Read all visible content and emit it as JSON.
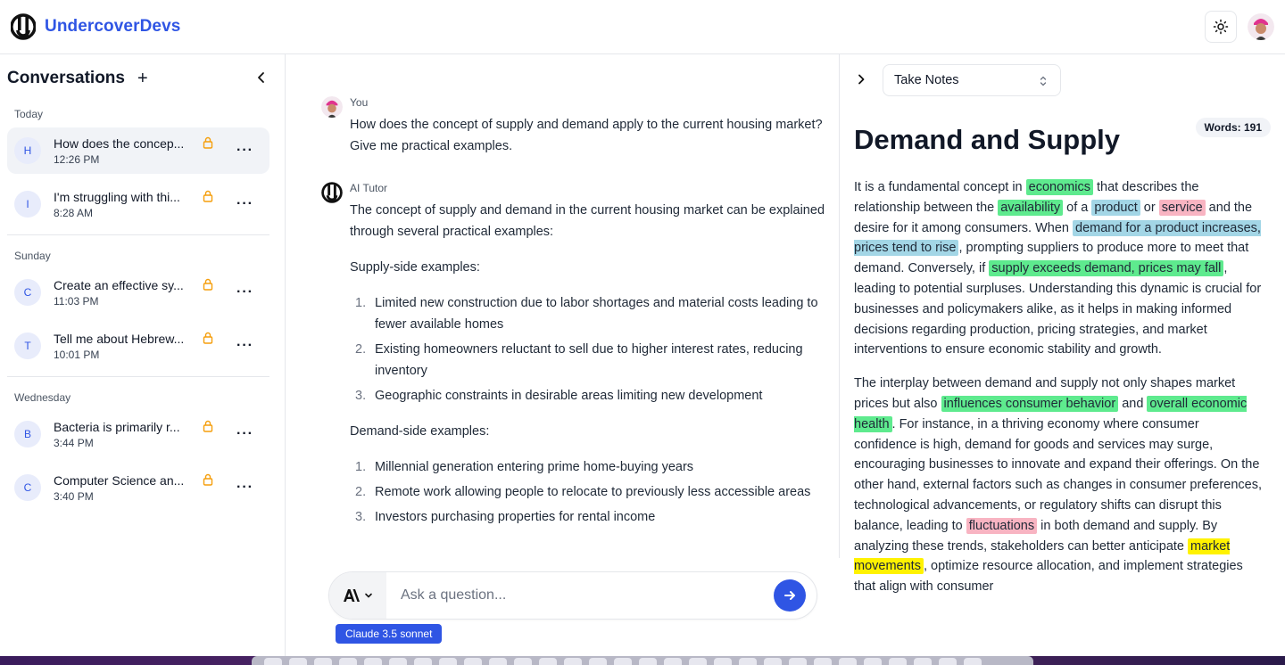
{
  "header": {
    "brand": "UndercoverDevs"
  },
  "sidebar": {
    "title": "Conversations",
    "add_label": "+",
    "groups": [
      {
        "label": "Today",
        "items": [
          {
            "initial": "H",
            "title": "How does the concep...",
            "time": "12:26 PM"
          },
          {
            "initial": "I",
            "title": "I'm struggling with thi...",
            "time": "8:28 AM"
          }
        ]
      },
      {
        "label": "Sunday",
        "items": [
          {
            "initial": "C",
            "title": "Create an effective sy...",
            "time": "11:03 PM"
          },
          {
            "initial": "T",
            "title": "Tell me about Hebrew...",
            "time": "10:01 PM"
          }
        ]
      },
      {
        "label": "Wednesday",
        "items": [
          {
            "initial": "B",
            "title": "Bacteria is primarily r...",
            "time": "3:44 PM"
          },
          {
            "initial": "C",
            "title": "Computer Science an...",
            "time": "3:40 PM"
          }
        ]
      }
    ]
  },
  "chat": {
    "user": {
      "name": "You",
      "text": "How does the concept of supply and demand apply to the current housing market? Give me practical examples."
    },
    "tutor": {
      "name": "AI Tutor",
      "intro": "The concept of supply and demand in the current housing market can be explained through several practical examples:",
      "supply_heading": "Supply-side examples:",
      "supply_items": [
        "Limited new construction due to labor shortages and material costs leading to fewer available homes",
        "Existing homeowners reluctant to sell due to higher interest rates, reducing inventory",
        "Geographic constraints in desirable areas limiting new development"
      ],
      "demand_heading": "Demand-side examples:",
      "demand_items": [
        "Millennial generation entering prime home-buying years",
        "Remote work allowing people to relocate to previously less accessible areas",
        "Investors purchasing properties for rental income"
      ]
    },
    "input_placeholder": "Ask a question...",
    "model_label": "Claude 3.5 sonnet"
  },
  "notes": {
    "mode": "Take Notes",
    "word_count": "Words: 191",
    "title": "Demand and Supply",
    "p1": {
      "t1": "It is a fundamental concept in ",
      "h1": "economics",
      "t2": " that describes the relationship between the ",
      "h2": "availability",
      "t3": " of a ",
      "h3": "product",
      "t4": " or ",
      "h4": "service",
      "t5": " and the desire for it among consumers. When ",
      "h5": "demand for a product increases, prices tend to rise",
      "t6": ", prompting suppliers to produce more to meet that demand. Conversely, if ",
      "h6": "supply exceeds demand, prices may fall",
      "t7": ", leading to potential surpluses. Understanding this dynamic is crucial for businesses and policymakers alike, as it helps in making informed decisions regarding production, pricing strategies, and market interventions to ensure economic stability and growth."
    },
    "p2": {
      "t1": "The interplay between demand and supply not only shapes market prices but also ",
      "h1": "influences consumer behavior",
      "t2": " and ",
      "h2": "overall economic health",
      "t3": ". For instance, in a thriving economy where consumer confidence is high, demand for goods and services may surge, encouraging businesses to innovate and expand their offerings. On the other hand, external factors such as changes in consumer preferences, technological advancements, or regulatory shifts can disrupt this balance, leading to ",
      "h3": "fluctuations",
      "t4": " in both demand and supply. By analyzing these trends, stakeholders can better anticipate ",
      "h4": "market movements",
      "t5": ", optimize resource allocation, and implement strategies that align with consumer"
    }
  }
}
